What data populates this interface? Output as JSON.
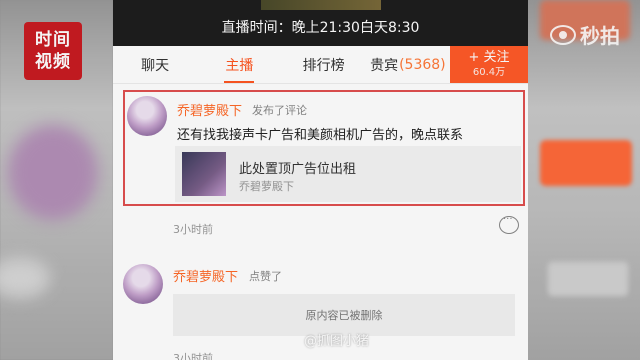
{
  "watermark": {
    "logo_line1": "时间",
    "logo_line2": "视频",
    "top_right": "秒拍",
    "bottom": "@抓图小猪"
  },
  "live": {
    "time_text": "直播时间：晚上21:30白天8:30"
  },
  "tabs": [
    {
      "label": "聊天"
    },
    {
      "label": "主播"
    },
    {
      "label": "排行榜"
    },
    {
      "label": "贵宾",
      "count": "(5368)"
    }
  ],
  "follow": {
    "label": "+ 关注",
    "count": "60.4万"
  },
  "feed": [
    {
      "nickname": "乔碧萝殿下",
      "action": "发布了评论",
      "comment": "还有找我接声卡广告和美颜相机广告的，晚点联系",
      "card_title": "此处置顶广告位出租",
      "card_sub": "乔碧萝殿下",
      "time": "3小时前"
    },
    {
      "nickname": "乔碧萝殿下",
      "action": "点赞了",
      "deleted_text": "原内容已被删除",
      "time": "3小时前"
    }
  ],
  "colors": {
    "accent": "#ff5722",
    "highlight_border": "#e05050",
    "logo_red": "#c81c22"
  }
}
